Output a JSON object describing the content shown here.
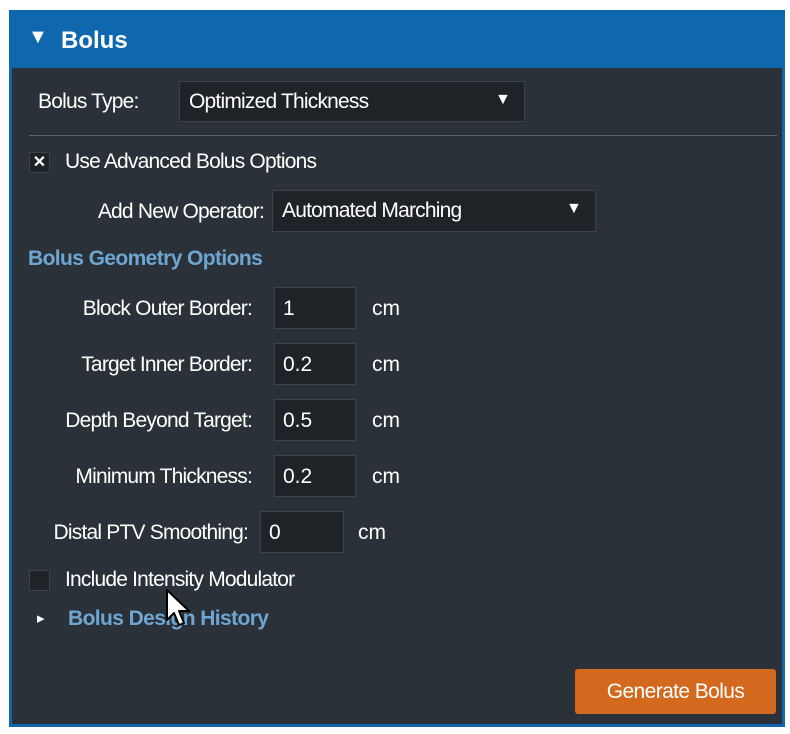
{
  "panel": {
    "title": "Bolus",
    "collapse_glyph": "▼"
  },
  "bolus_type": {
    "label": "Bolus Type:",
    "value": "Optimized Thickness"
  },
  "advanced": {
    "checked_glyph": "✕",
    "label": "Use Advanced Bolus Options",
    "checked": true
  },
  "operator": {
    "label": "Add New Operator:",
    "value": "Automated Marching"
  },
  "geometry": {
    "heading": "Bolus Geometry Options",
    "rows": [
      {
        "label": "Block Outer Border:",
        "value": "1",
        "unit": "cm"
      },
      {
        "label": "Target Inner Border:",
        "value": "0.2",
        "unit": "cm"
      },
      {
        "label": "Depth Beyond Target:",
        "value": "0.5",
        "unit": "cm"
      },
      {
        "label": "Minimum Thickness:",
        "value": "0.2",
        "unit": "cm"
      },
      {
        "label": "Distal PTV Smoothing:",
        "value": "0",
        "unit": "cm"
      }
    ]
  },
  "intensity": {
    "label": "Include Intensity Modulator",
    "checked": false
  },
  "history": {
    "expand_glyph": "▸",
    "label": "Bolus Design History"
  },
  "actions": {
    "generate_label": "Generate Bolus"
  },
  "colors": {
    "panel_bg": "#2b3138",
    "header_bg": "#0f68ad",
    "accent_button": "#d2691e",
    "section_heading": "#6ea6d2"
  },
  "icons": {
    "caret": "▼",
    "cursor": "mouse-pointer-icon"
  }
}
